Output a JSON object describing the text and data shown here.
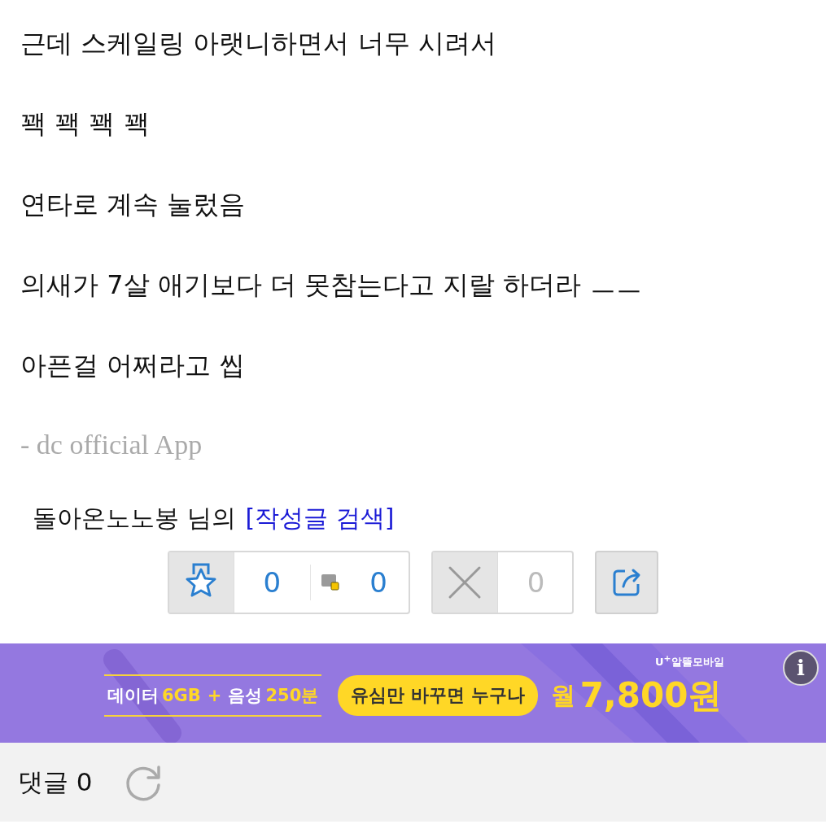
{
  "paragraphs": [
    "근데 스케일링 아랫니하면서 너무 시려서",
    "꽥 꽥 꽥 꽥",
    "연타로 계속 눌렀음",
    "의새가 7살 애기보다 더 못참는다고 지랄 하더라 ㅡㅡ",
    "아픈걸 어쩌라고 씹"
  ],
  "signature": "- dc official App",
  "author": {
    "name": "돌아온노노봉 님의",
    "link": "[작성글 검색]"
  },
  "votes": {
    "recommend": "0",
    "fixed_recommend": "0",
    "not_recommend": "0"
  },
  "ad": {
    "logo": "U$^{+}$알뜰모바일",
    "data_label": "데이터",
    "data_value": "6GB",
    "plus": "+",
    "voice_label": "음성",
    "voice_value": "250분",
    "bubble": "유심만 바꾸면 누구나",
    "price_prefix": "월",
    "price": "7,800원",
    "info": "i"
  },
  "comments": {
    "label": "댓글",
    "count": "0"
  }
}
